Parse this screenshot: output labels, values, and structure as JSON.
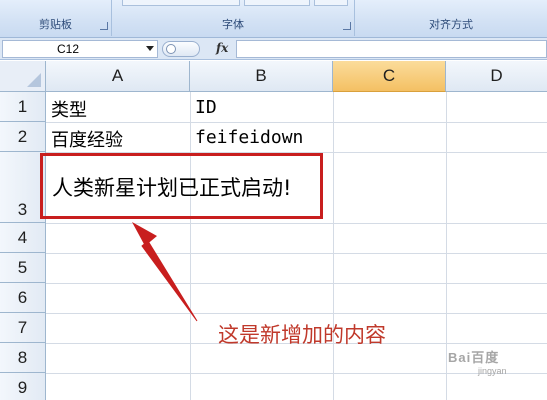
{
  "ribbon": {
    "groups": [
      {
        "label": "剪贴板"
      },
      {
        "label": "字体"
      },
      {
        "label": "对齐方式"
      }
    ]
  },
  "formula_bar": {
    "name_box": "C12",
    "fx_label": "fx",
    "formula": ""
  },
  "columns": [
    "A",
    "B",
    "C",
    "D"
  ],
  "selected_column": "C",
  "rows": [
    "1",
    "2",
    "3",
    "4",
    "5",
    "6",
    "7",
    "8",
    "9"
  ],
  "cells": {
    "A1": "类型",
    "B1": "ID",
    "A2": "百度经验",
    "B2": "feifeidown",
    "A3": "人类新星计划已正式启动!"
  },
  "annotation": {
    "note": "这是新增加的内容",
    "color": "#c81e1e"
  },
  "watermark": {
    "text": "Bai百度",
    "sub": "jingyan"
  }
}
